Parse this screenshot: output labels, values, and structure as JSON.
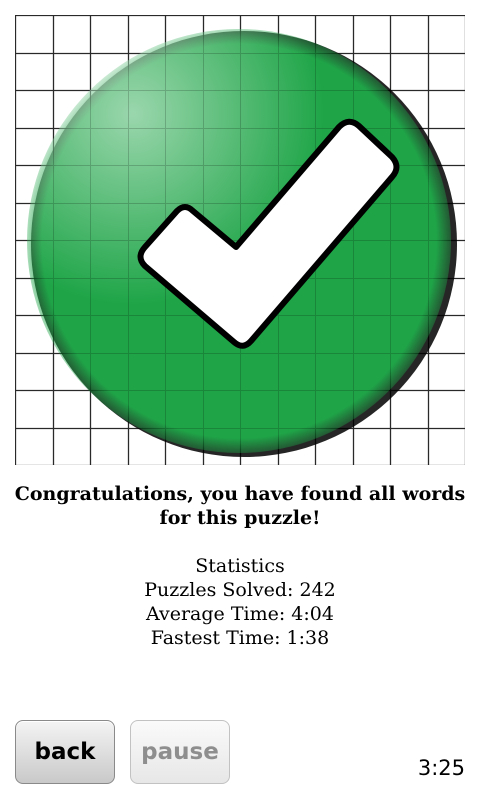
{
  "result": {
    "message": "Congratulations, you have found all words for this puzzle!"
  },
  "statistics": {
    "heading": "Statistics",
    "puzzles_solved": "Puzzles Solved: 242",
    "average_time": "Average Time: 4:04",
    "fastest_time": "Fastest Time: 1:38"
  },
  "controls": {
    "back_label": "back",
    "pause_label": "pause",
    "timer": "3:25"
  },
  "grid": {
    "rows": 12,
    "cols": 12
  },
  "icons": {
    "success": "checkmark-icon"
  },
  "colors": {
    "success_green": "#1fa548",
    "grid_line": "#333333"
  }
}
